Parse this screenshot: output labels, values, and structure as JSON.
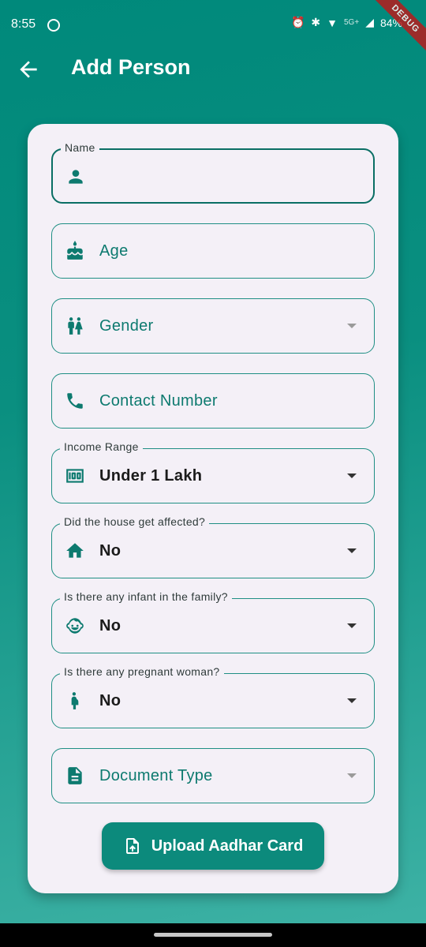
{
  "status_bar": {
    "time": "8:55",
    "network": "5G+",
    "battery": "84%"
  },
  "debug_banner": "DEBUG",
  "app_bar": {
    "title": "Add Person",
    "back_icon": "arrow-back-icon"
  },
  "form": {
    "name": {
      "label": "Name",
      "value": "",
      "icon": "person-icon"
    },
    "age": {
      "placeholder": "Age",
      "icon": "cake-icon"
    },
    "gender": {
      "placeholder": "Gender",
      "icon": "wc-icon"
    },
    "contact": {
      "placeholder": "Contact Number",
      "icon": "phone-icon"
    },
    "income": {
      "label": "Income Range",
      "value": "Under 1 Lakh",
      "icon": "money-icon"
    },
    "house": {
      "label": "Did the house get affected?",
      "value": "No",
      "icon": "home-icon"
    },
    "infant": {
      "label": "Is there any infant in the family?",
      "value": "No",
      "icon": "child-face-icon"
    },
    "pregnant": {
      "label": "Is there any pregnant woman?",
      "value": "No",
      "icon": "pregnant-woman-icon"
    },
    "document": {
      "placeholder": "Document Type",
      "icon": "document-icon"
    }
  },
  "upload_button": {
    "label": "Upload Aadhar Card",
    "icon": "upload-file-icon"
  },
  "colors": {
    "primary": "#00897b",
    "card": "#f4f0f7",
    "accent_text": "#0d7a6f"
  }
}
